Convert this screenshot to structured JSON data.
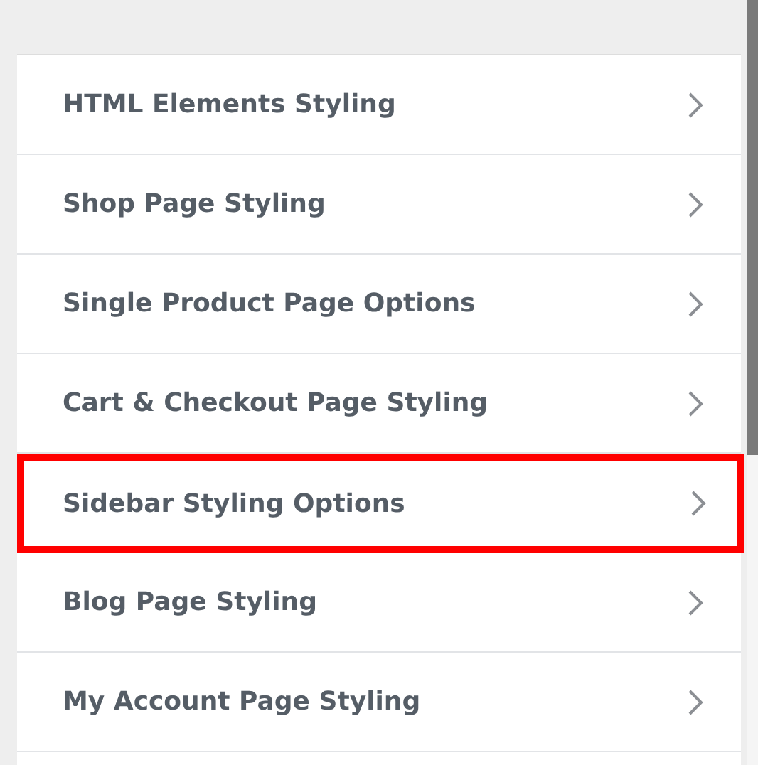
{
  "sections": [
    {
      "label": "HTML Elements Styling",
      "highlighted": false
    },
    {
      "label": "Shop Page Styling",
      "highlighted": false
    },
    {
      "label": "Single Product Page Options",
      "highlighted": false
    },
    {
      "label": "Cart & Checkout Page Styling",
      "highlighted": false
    },
    {
      "label": "Sidebar Styling Options",
      "highlighted": true
    },
    {
      "label": "Blog Page Styling",
      "highlighted": false
    },
    {
      "label": "My Account Page Styling",
      "highlighted": false
    }
  ]
}
